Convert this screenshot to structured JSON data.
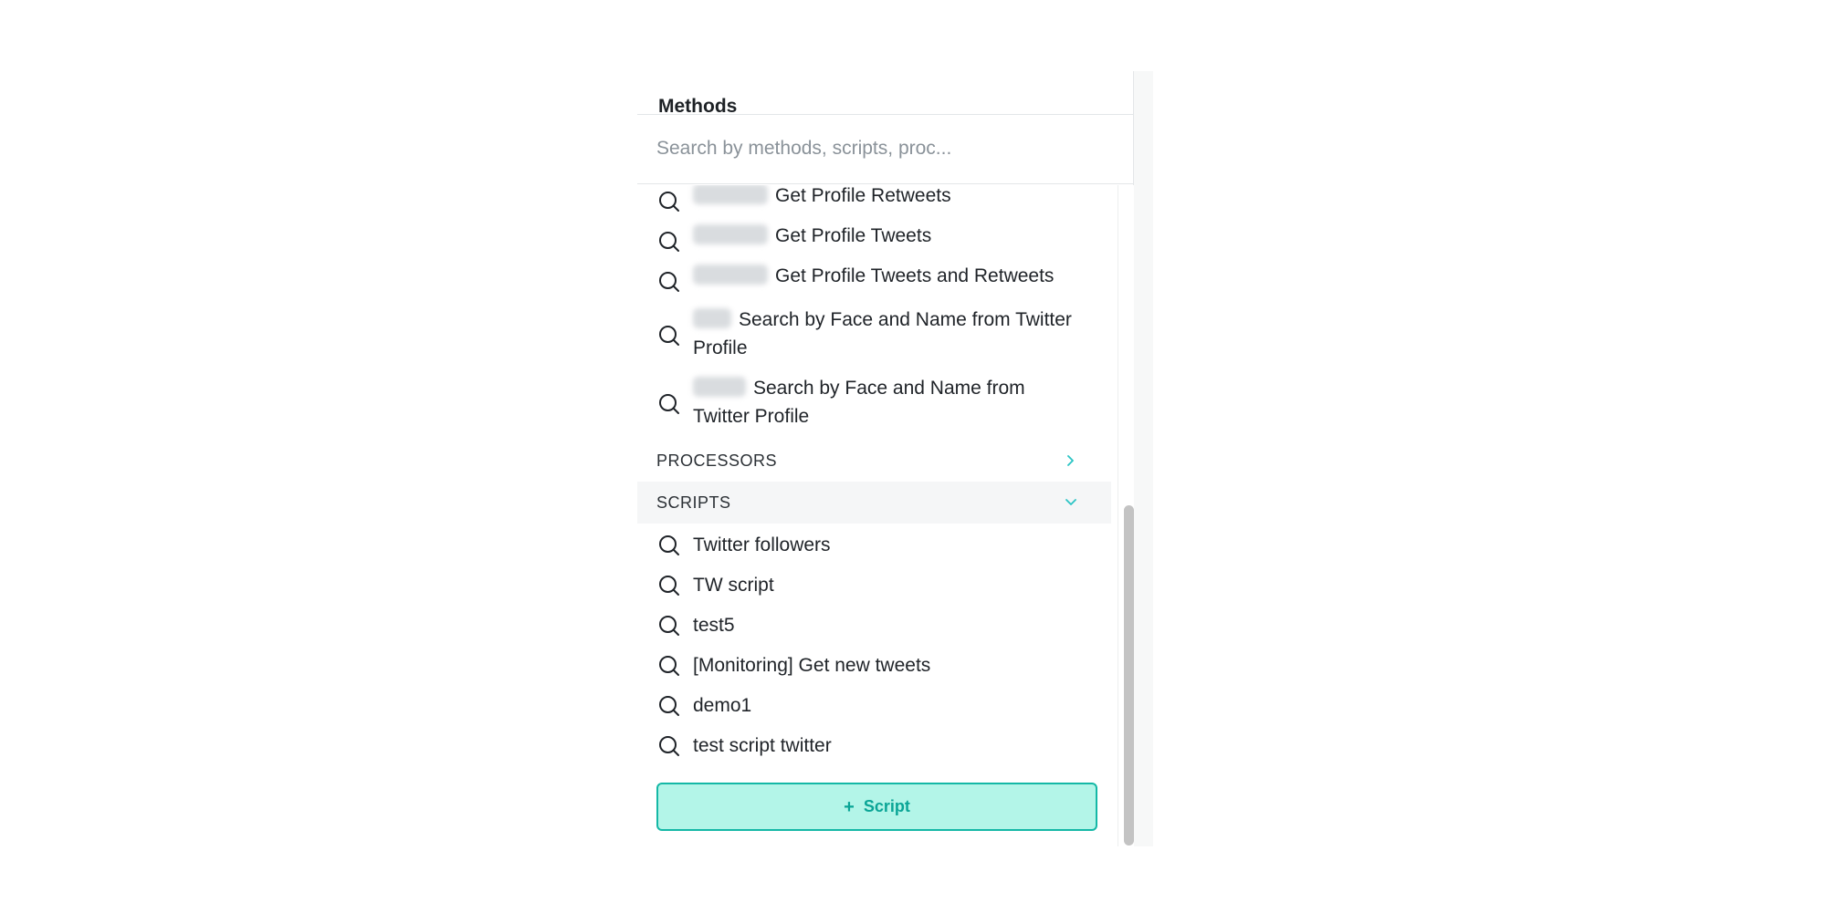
{
  "panel": {
    "title": "Methods",
    "search_placeholder": "Search by methods, scripts, proc..."
  },
  "methods": [
    {
      "label": "Get Profile Retweets",
      "blurred_prefix": true
    },
    {
      "label": "Get Profile Tweets",
      "blurred_prefix": true
    },
    {
      "label": "Get Profile Tweets and Retweets",
      "blurred_prefix": true
    },
    {
      "label": "Search by Face and Name from Twitter Profile",
      "blurred_prefix": true
    },
    {
      "label": "Search by Face and Name from Twitter Profile",
      "blurred_prefix": true
    }
  ],
  "sections": {
    "processors": {
      "label": "PROCESSORS",
      "state": "collapsed"
    },
    "scripts": {
      "label": "SCRIPTS",
      "state": "expanded"
    }
  },
  "scripts": [
    "Twitter followers",
    "TW script",
    "test5",
    "[Monitoring] Get new tweets",
    "demo1",
    "test script twitter"
  ],
  "add_button": {
    "label": "Script",
    "icon": "plus-icon"
  },
  "colors": {
    "accent": "#14b8a6",
    "accent_fill": "#b3f5e8",
    "chevron": "#2bc4c4"
  }
}
